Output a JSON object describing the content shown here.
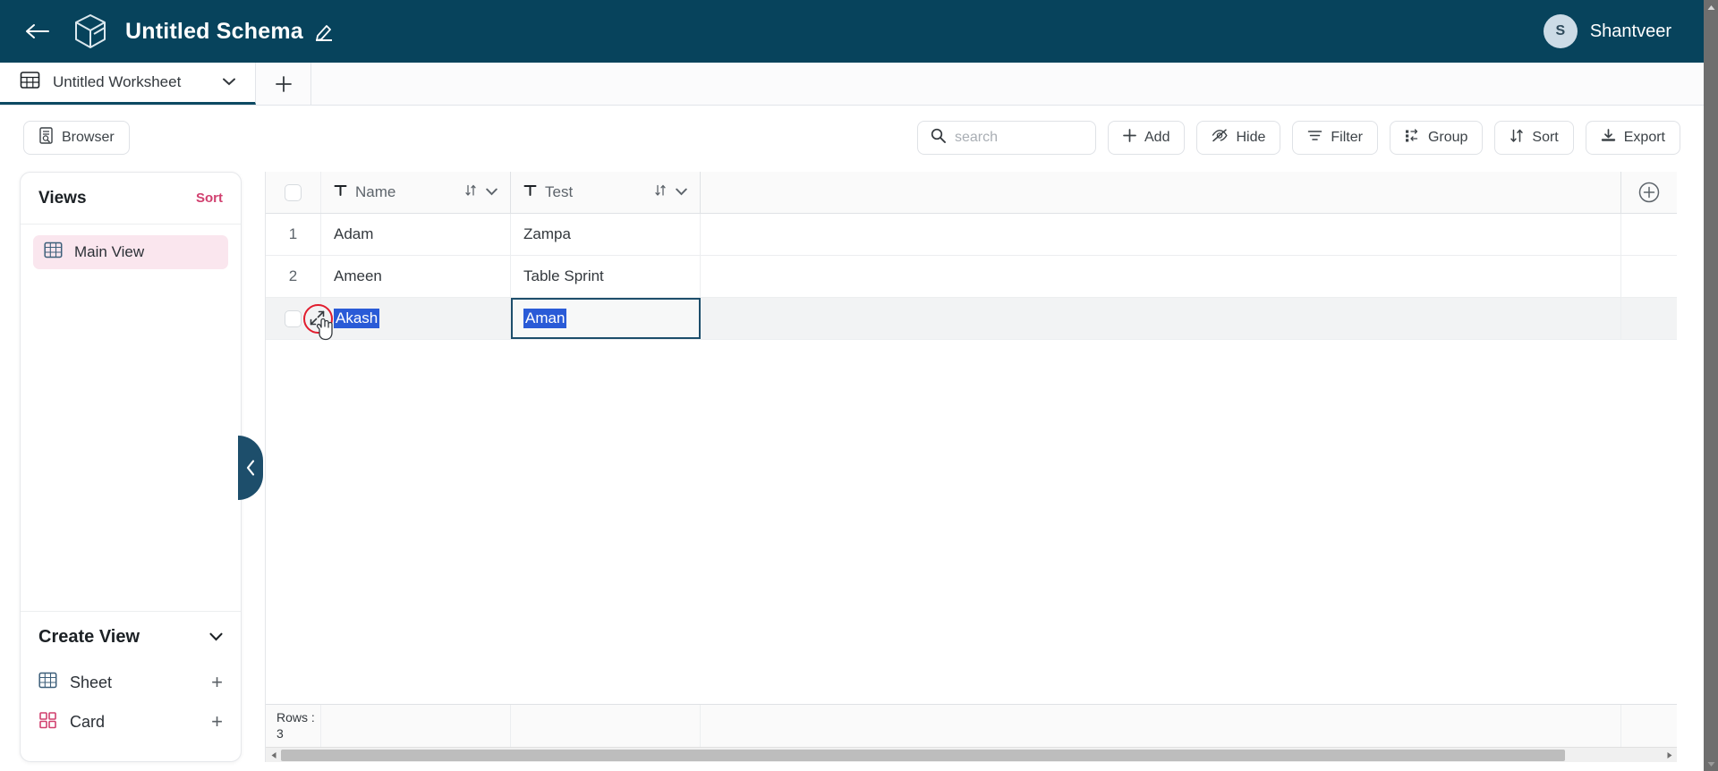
{
  "header": {
    "back_icon": "back-arrow-icon",
    "logo_icon": "cube-logo-icon",
    "title": "Untitled Schema",
    "edit_icon": "pencil-icon",
    "user": {
      "initial": "S",
      "name": "Shantveer"
    },
    "bg_color": "#07435c"
  },
  "tabbar": {
    "tabs": [
      {
        "label": "Untitled Worksheet",
        "icon": "grid-icon",
        "chevron": "chevron-down-icon",
        "active": true
      }
    ],
    "add_label": "+"
  },
  "toolbar": {
    "browser_label": "Browser",
    "search": {
      "value": "",
      "placeholder": "search"
    },
    "buttons": [
      {
        "label": "Add",
        "icon": "plus-icon"
      },
      {
        "label": "Hide",
        "icon": "eye-off-icon"
      },
      {
        "label": "Filter",
        "icon": "filter-icon"
      },
      {
        "label": "Group",
        "icon": "group-icon"
      },
      {
        "label": "Sort",
        "icon": "sort-icon"
      },
      {
        "label": "Export",
        "icon": "download-icon"
      }
    ]
  },
  "sidebar": {
    "views_title": "Views",
    "sort_label": "Sort",
    "sort_color": "#d1406f",
    "views": [
      {
        "label": "Main View",
        "icon": "grid-icon",
        "selected": true
      }
    ],
    "create_view": {
      "title": "Create View",
      "chevron": "chevron-down-icon",
      "options": [
        {
          "label": "Sheet",
          "icon": "grid-icon",
          "add": "+"
        },
        {
          "label": "Card",
          "icon": "card-icon",
          "add": "+"
        }
      ]
    },
    "collapse_icon": "chevron-left-icon"
  },
  "grid": {
    "columns": [
      {
        "label": "Name",
        "type_icon": "text-type-icon",
        "sort_icon": "sort-arrows-icon",
        "chevron": "chevron-down-icon"
      },
      {
        "label": "Test",
        "type_icon": "text-type-icon",
        "sort_icon": "sort-arrows-icon",
        "chevron": "chevron-down-icon"
      }
    ],
    "add_column_icon": "circle-plus-icon",
    "rows": [
      {
        "num": "1",
        "name": "Adam",
        "test": "Zampa",
        "active": false
      },
      {
        "num": "2",
        "name": "Ameen",
        "test": "Table Sprint",
        "active": false
      },
      {
        "num": "",
        "name": "Akash",
        "test": "Aman",
        "active": true
      }
    ],
    "footer": {
      "rows_label": "Rows :",
      "rows_count": "3"
    },
    "selection_color": "#2a5bd7",
    "active_cell_border": "#1d4e6b"
  },
  "annotation": {
    "circle_color": "#e11d2e",
    "target_icon": "expand-arrows-icon",
    "cursor_icon": "hand-cursor-icon"
  }
}
